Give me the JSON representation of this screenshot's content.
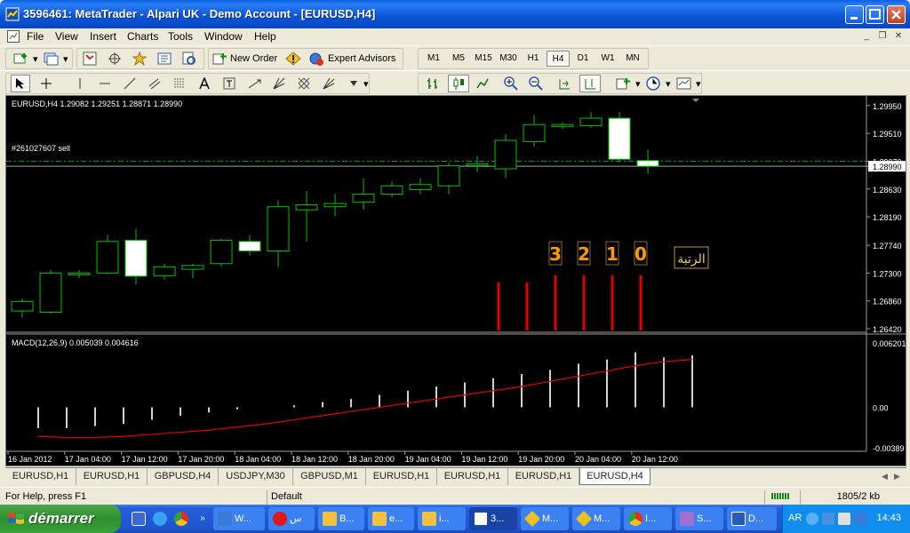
{
  "window": {
    "title": "3596461: MetaTrader - Alpari UK - Demo Account - [EURUSD,H4]"
  },
  "menu": [
    "File",
    "View",
    "Insert",
    "Charts",
    "Tools",
    "Window",
    "Help"
  ],
  "toolbar": {
    "new_order": "New Order",
    "expert_advisors": "Expert Advisors",
    "timeframes": [
      "M1",
      "M5",
      "M15",
      "M30",
      "H1",
      "H4",
      "D1",
      "W1",
      "MN"
    ],
    "active_timeframe": "H4"
  },
  "chart_data": {
    "type": "candlestick",
    "symbol_header": "EURUSD,H4  1.29082 1.29251 1.28871 1.28990",
    "order_line_label": "#261027607 sell",
    "order_line_price": 1.2907,
    "bid_price": 1.2899,
    "price_ticks": [
      "1.29950",
      "1.29510",
      "1.29070",
      "1.28990",
      "1.28630",
      "1.28190",
      "1.27740",
      "1.27300",
      "1.26860",
      "1.26420"
    ],
    "ylim": [
      1.2642,
      1.2999
    ],
    "candles": [
      [
        1.267,
        1.269,
        1.266,
        1.2685
      ],
      [
        1.2668,
        1.2735,
        1.2665,
        1.273
      ],
      [
        1.2728,
        1.2735,
        1.2722,
        1.273
      ],
      [
        1.273,
        1.279,
        1.2728,
        1.278
      ],
      [
        1.2782,
        1.28,
        1.2712,
        1.2725
      ],
      [
        1.2726,
        1.2745,
        1.272,
        1.274
      ],
      [
        1.2736,
        1.2745,
        1.2722,
        1.2742
      ],
      [
        1.2745,
        1.2785,
        1.274,
        1.2782
      ],
      [
        1.278,
        1.279,
        1.2758,
        1.2765
      ],
      [
        1.2765,
        1.2845,
        1.274,
        1.2835
      ],
      [
        1.283,
        1.286,
        1.278,
        1.2838
      ],
      [
        1.2835,
        1.2855,
        1.282,
        1.284
      ],
      [
        1.2842,
        1.288,
        1.283,
        1.2855
      ],
      [
        1.2855,
        1.2875,
        1.285,
        1.2868
      ],
      [
        1.2862,
        1.288,
        1.2855,
        1.287
      ],
      [
        1.2868,
        1.2905,
        1.2855,
        1.29
      ],
      [
        1.29,
        1.2915,
        1.289,
        1.2903
      ],
      [
        1.2895,
        1.295,
        1.288,
        1.294
      ],
      [
        1.2938,
        1.298,
        1.293,
        1.2965
      ],
      [
        1.2962,
        1.2968,
        1.2958,
        1.2965
      ],
      [
        1.2963,
        1.2985,
        1.296,
        1.2975
      ],
      [
        1.2975,
        1.2985,
        1.2905,
        1.291
      ],
      [
        1.2908,
        1.2925,
        1.2887,
        1.2899
      ]
    ],
    "markers": [
      "3",
      "2",
      "1",
      "0"
    ],
    "arabic_label": "الرتبة",
    "macd": {
      "header": "MACD(12,26,9) 0.005039 0.004616",
      "ticks": [
        "0.006201",
        "0.00",
        "-0.00389"
      ],
      "ylim": [
        -0.00389,
        0.006201
      ],
      "histogram": [
        -0.002,
        -0.002,
        -0.0018,
        -0.0016,
        -0.0012,
        -0.0008,
        -0.0005,
        -0.0002,
        0.0,
        0.0002,
        0.0005,
        0.0008,
        0.0012,
        0.0016,
        0.002,
        0.0024,
        0.0028,
        0.0032,
        0.0036,
        0.0042,
        0.0046,
        0.0053,
        0.0048,
        0.005
      ],
      "signal": [
        -0.0028,
        -0.0029,
        -0.0029,
        -0.0028,
        -0.0026,
        -0.0024,
        -0.0022,
        -0.0019,
        -0.0016,
        -0.0012,
        -0.0008,
        -0.0004,
        0.0,
        0.0004,
        0.0008,
        0.0012,
        0.0016,
        0.002,
        0.0025,
        0.003,
        0.0035,
        0.004,
        0.0044,
        0.0046
      ]
    },
    "time_ticks": [
      "16 Jan 2012",
      "17 Jan 04:00",
      "17 Jan 12:00",
      "17 Jan 20:00",
      "18 Jan 04:00",
      "18 Jan 12:00",
      "18 Jan 20:00",
      "19 Jan 04:00",
      "19 Jan 12:00",
      "19 Jan 20:00",
      "20 Jan 04:00",
      "20 Jan 12:00"
    ],
    "colors": {
      "background": "#000000",
      "bull_body": "#000000",
      "bear_body": "#ffffff",
      "candle_outline": "#00c000",
      "marker_bar": "#e00000",
      "marker_text": "#ff9900",
      "signal_line": "#e00000",
      "histogram": "#d0d0d0",
      "order_line": "#00a000"
    }
  },
  "tabs": [
    "EURUSD,H1",
    "EURUSD,H1",
    "GBPUSD,H4",
    "USDJPY,M30",
    "GBPUSD,M1",
    "EURUSD,H1",
    "EURUSD,H1",
    "EURUSD,H1",
    "EURUSD,H4"
  ],
  "active_tab_index": 8,
  "status": {
    "help": "For Help, press F1",
    "profile": "Default",
    "traffic": "1805/2 kb"
  },
  "taskbar": {
    "start": "démarrer",
    "tasks": [
      "W...",
      "س",
      "B...",
      "e...",
      "i...",
      "3...",
      "M...",
      "M...",
      "I...",
      "S...",
      "D..."
    ],
    "active_task_index": 5,
    "lang": "AR",
    "clock": "14:43"
  }
}
